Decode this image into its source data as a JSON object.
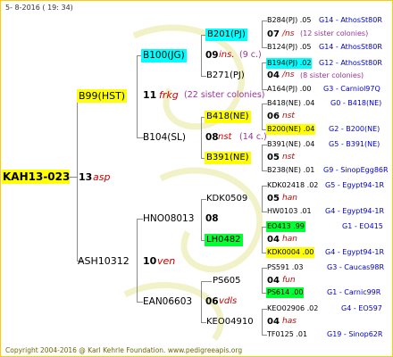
{
  "header": "5- 8-2016 ( 19: 34)",
  "footer": "Copyright 2004-2016 @ Karl Kehrle Foundation.   www.pedigreeapis.org",
  "colors": {
    "yellow": "#ffff00",
    "cyan": "#00ffff",
    "green": "#00ff33",
    "red": "#cc0000",
    "blue": "#0000cc",
    "purple": "#993399",
    "gray": "#777777",
    "frame": "#ffcc00"
  },
  "root": {
    "code": "KAH13-023",
    "num": "13",
    "ins": "asp"
  },
  "g1": [
    {
      "code": "B99(HST)",
      "num": "11",
      "ins": "frkg",
      "note": "(22 sister colonies)"
    },
    {
      "code": "ASH10312",
      "num": "10",
      "ins": "ven"
    }
  ],
  "g2": [
    {
      "code": "B100(JG)",
      "num": "09",
      "ins": "ins.",
      "note": "(9 c.)"
    },
    {
      "code": "B104(SL)",
      "num": "08",
      "ins": "nst",
      "note": "(14 c.)"
    },
    {
      "code": "HNO08013",
      "num": "08",
      "ins": "",
      "note": ""
    },
    {
      "code": "EAN06603",
      "num": "06",
      "ins": "vdls",
      "note": ""
    }
  ],
  "g3": [
    {
      "code": "B201(PJ)",
      "num": "07",
      "ins": "/ns",
      "note": "(12 sister colonies)"
    },
    {
      "code": "B271(PJ)",
      "num": "04",
      "ins": "/ns",
      "note": "(8 sister colonies)"
    },
    {
      "code": "B418(NE)",
      "num": "06",
      "ins": "nst",
      "note": ""
    },
    {
      "code": "B391(NE)",
      "num": "05",
      "ins": "nst",
      "note": ""
    },
    {
      "code": "KDK0509",
      "num": "05",
      "ins": "han",
      "note": ""
    },
    {
      "code": "LH0482",
      "num": "04",
      "ins": "han",
      "note": ""
    },
    {
      "code": "PS605",
      "num": "04",
      "ins": "fun",
      "note": ""
    },
    {
      "code": "KEO04910",
      "num": "04",
      "ins": "has",
      "note": ""
    }
  ],
  "g4": [
    {
      "left": "B284(PJ) .05",
      "right": "G14 - AthosSt80R"
    },
    {
      "left": "B124(PJ) .05",
      "right": "G14 - AthosSt80R"
    },
    {
      "left": "B194(PJ) .02",
      "right": "G12 - AthosSt80R"
    },
    {
      "left": "A164(PJ) .00",
      "right": "G3 - Carniol97Q"
    },
    {
      "left": "B418(NE) .04",
      "right": "G0 - B418(NE)"
    },
    {
      "left": "B200(NE) .04",
      "right": "G2 - B200(NE)"
    },
    {
      "left": "B391(NE) .04",
      "right": "G5 - B391(NE)"
    },
    {
      "left": "B238(NE) .01",
      "right": "G9 - SinopEgg86R"
    },
    {
      "left": "KDK02418 .02",
      "right": "G5 - Egypt94-1R"
    },
    {
      "left": "HW0103 .01",
      "right": "G4 - Egypt94-1R"
    },
    {
      "left": "EO413 .99",
      "right": "G1 - EO415"
    },
    {
      "left": "KDK0004 .00",
      "right": "G4 - Egypt94-1R"
    },
    {
      "left": "PS591 .03",
      "right": "G3 - Caucas98R"
    },
    {
      "left": "PS614 .00",
      "right": "G1 - Carnic99R"
    },
    {
      "left": "KEO02906 .02",
      "right": "G4 - EO597"
    },
    {
      "left": "TF0125 .01",
      "right": "G19 - Sinop62R"
    }
  ]
}
